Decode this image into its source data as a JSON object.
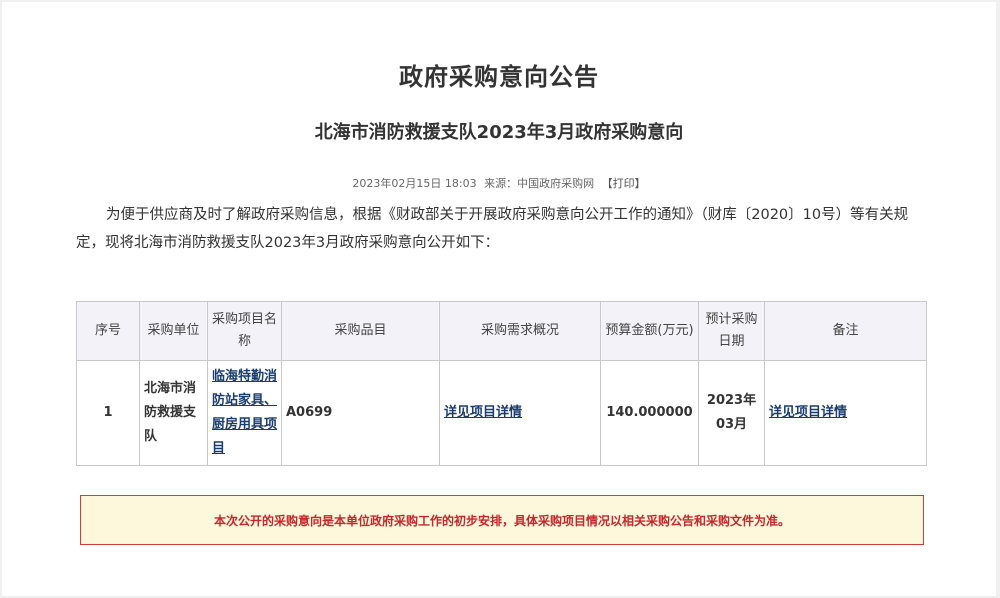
{
  "main_title": "政府采购意向公告",
  "sub_title": "北海市消防救援支队2023年3月政府采购意向",
  "meta": {
    "datetime": "2023年02月15日 18:03",
    "source_label": "来源：中国政府采购网",
    "print_label": "【打印】"
  },
  "intro": "为便于供应商及时了解政府采购信息，根据《财政部关于开展政府采购意向公开工作的通知》（财库〔2020〕10号）等有关规定，现将北海市消防救援支队2023年3月政府采购意向公开如下：",
  "table": {
    "headers": {
      "seq": "序号",
      "unit": "采购单位",
      "project": "采购项目名称",
      "item": "采购品目",
      "needs": "采购需求概况",
      "budget": "预算金额(万元)",
      "date": "预计采购日期",
      "remark": "备注"
    },
    "rows": [
      {
        "seq": "1",
        "unit": "北海市消防救援支队",
        "project": "临海特勤消防站家具、厨房用具项目",
        "item": "A0699",
        "needs": "详见项目详情",
        "budget": "140.000000",
        "date": "2023年03月",
        "remark": "详见项目详情"
      }
    ]
  },
  "notice": "本次公开的采购意向是本单位政府采购工作的初步安排，具体采购项目情况以相关采购公告和采购文件为准。",
  "colors": {
    "notice_bg": "#fdf7dc",
    "notice_border": "#cf3a3a",
    "notice_text": "#c8262b",
    "link": "#1a3c6e",
    "header_bg": "#f2f2f8"
  }
}
